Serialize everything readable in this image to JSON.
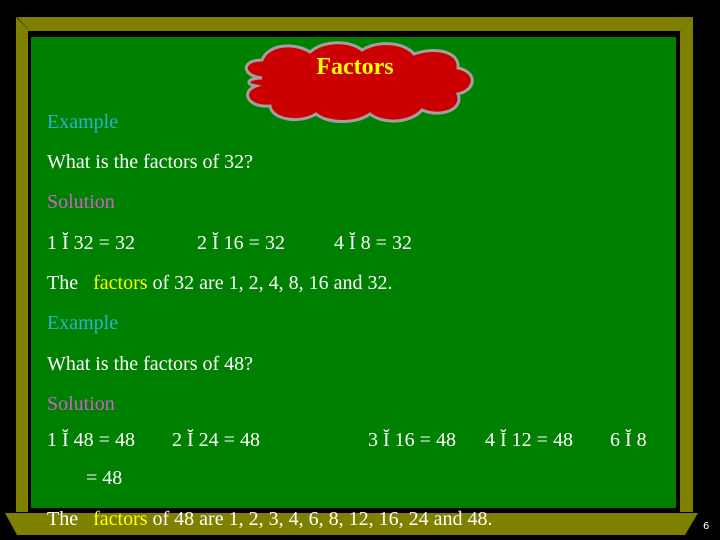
{
  "slide": {
    "title": "Factors",
    "page_number": "6",
    "colors": {
      "board": "#008000",
      "frame": "#808000",
      "cloud": "#cc0000",
      "cloud_outline": "#a0a0a0",
      "title": "#ffff00",
      "example": "#29b3cc",
      "solution": "#c863c8",
      "highlight": "#ffff00",
      "text": "#ffffff"
    }
  },
  "example1": {
    "label": "Example",
    "question": "What is the factors of 32?",
    "solution_label": "Solution",
    "products": [
      "1 Ĭ 32 = 32",
      "2 Ĭ 16 = 32",
      "4 Ĭ 8 = 32"
    ],
    "answer_prefix": "The",
    "answer_highlight": "factors",
    "answer_suffix": "of 32 are 1, 2, 4, 8, 16 and 32."
  },
  "example2": {
    "label": "Example",
    "question": "What is the factors of 48?",
    "solution_label": "Solution",
    "products": [
      "1 Ĭ 48 = 48",
      "2 Ĭ 24 = 48",
      "3 Ĭ 16 = 48",
      "4 Ĭ 12 = 48",
      "6 Ĭ 8"
    ],
    "product_continuation": "= 48",
    "answer_prefix": "The",
    "answer_highlight": "factors",
    "answer_suffix": "of 48 are 1, 2, 3, 4, 6, 8, 12, 16, 24 and 48."
  }
}
